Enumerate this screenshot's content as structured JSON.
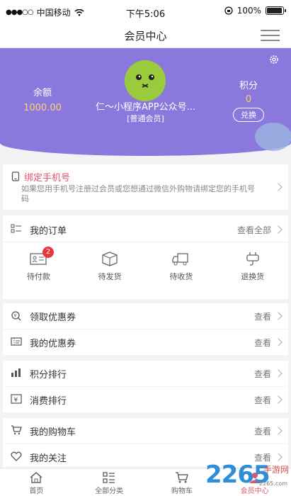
{
  "status_bar": {
    "carrier": "中国移动",
    "time": "下午5:06",
    "battery": "100%",
    "battery_level": 1.0
  },
  "nav": {
    "title": "会员中心"
  },
  "header": {
    "balance_label": "余额",
    "balance_value": "1000.00",
    "nickname": "仁～小程序APP公众号...",
    "level": "[普通会员]",
    "points_label": "积分",
    "points_value": "0",
    "redeem_label": "兑换",
    "bg_color": "#8b78dd"
  },
  "bind_phone": {
    "title": "绑定手机号",
    "desc": "如果您用手机号注册过会员或您想通过微信外购物请绑定您的手机号码"
  },
  "orders": {
    "label": "我的订单",
    "more": "查看全部",
    "items": [
      {
        "label": "待付款",
        "icon": "pay-icon",
        "badge": "2"
      },
      {
        "label": "待发货",
        "icon": "box-icon"
      },
      {
        "label": "待收货",
        "icon": "truck-icon"
      },
      {
        "label": "退换货",
        "icon": "return-icon"
      }
    ]
  },
  "rows": [
    {
      "label": "领取优惠券",
      "more": "查看",
      "icon": "coupon-receive-icon"
    },
    {
      "label": "我的优惠券",
      "more": "查看",
      "icon": "coupon-icon"
    },
    {
      "label": "积分排行",
      "more": "查看",
      "icon": "bar-chart-icon"
    },
    {
      "label": "消费排行",
      "more": "查看",
      "icon": "yen-icon"
    },
    {
      "label": "我的购物车",
      "more": "查看",
      "icon": "cart-icon"
    },
    {
      "label": "我的关注",
      "more": "查看",
      "icon": "heart-icon"
    }
  ],
  "tabs": [
    {
      "label": "首页",
      "icon": "home-icon"
    },
    {
      "label": "全部分类",
      "icon": "category-icon"
    },
    {
      "label": "购物车",
      "icon": "cart-icon"
    },
    {
      "label": "会员中心",
      "icon": "user-icon",
      "active": true
    }
  ],
  "watermark": {
    "brand": "2265",
    "site": "手游网",
    "url": "2265.com"
  },
  "accent_color": "#e0566b"
}
